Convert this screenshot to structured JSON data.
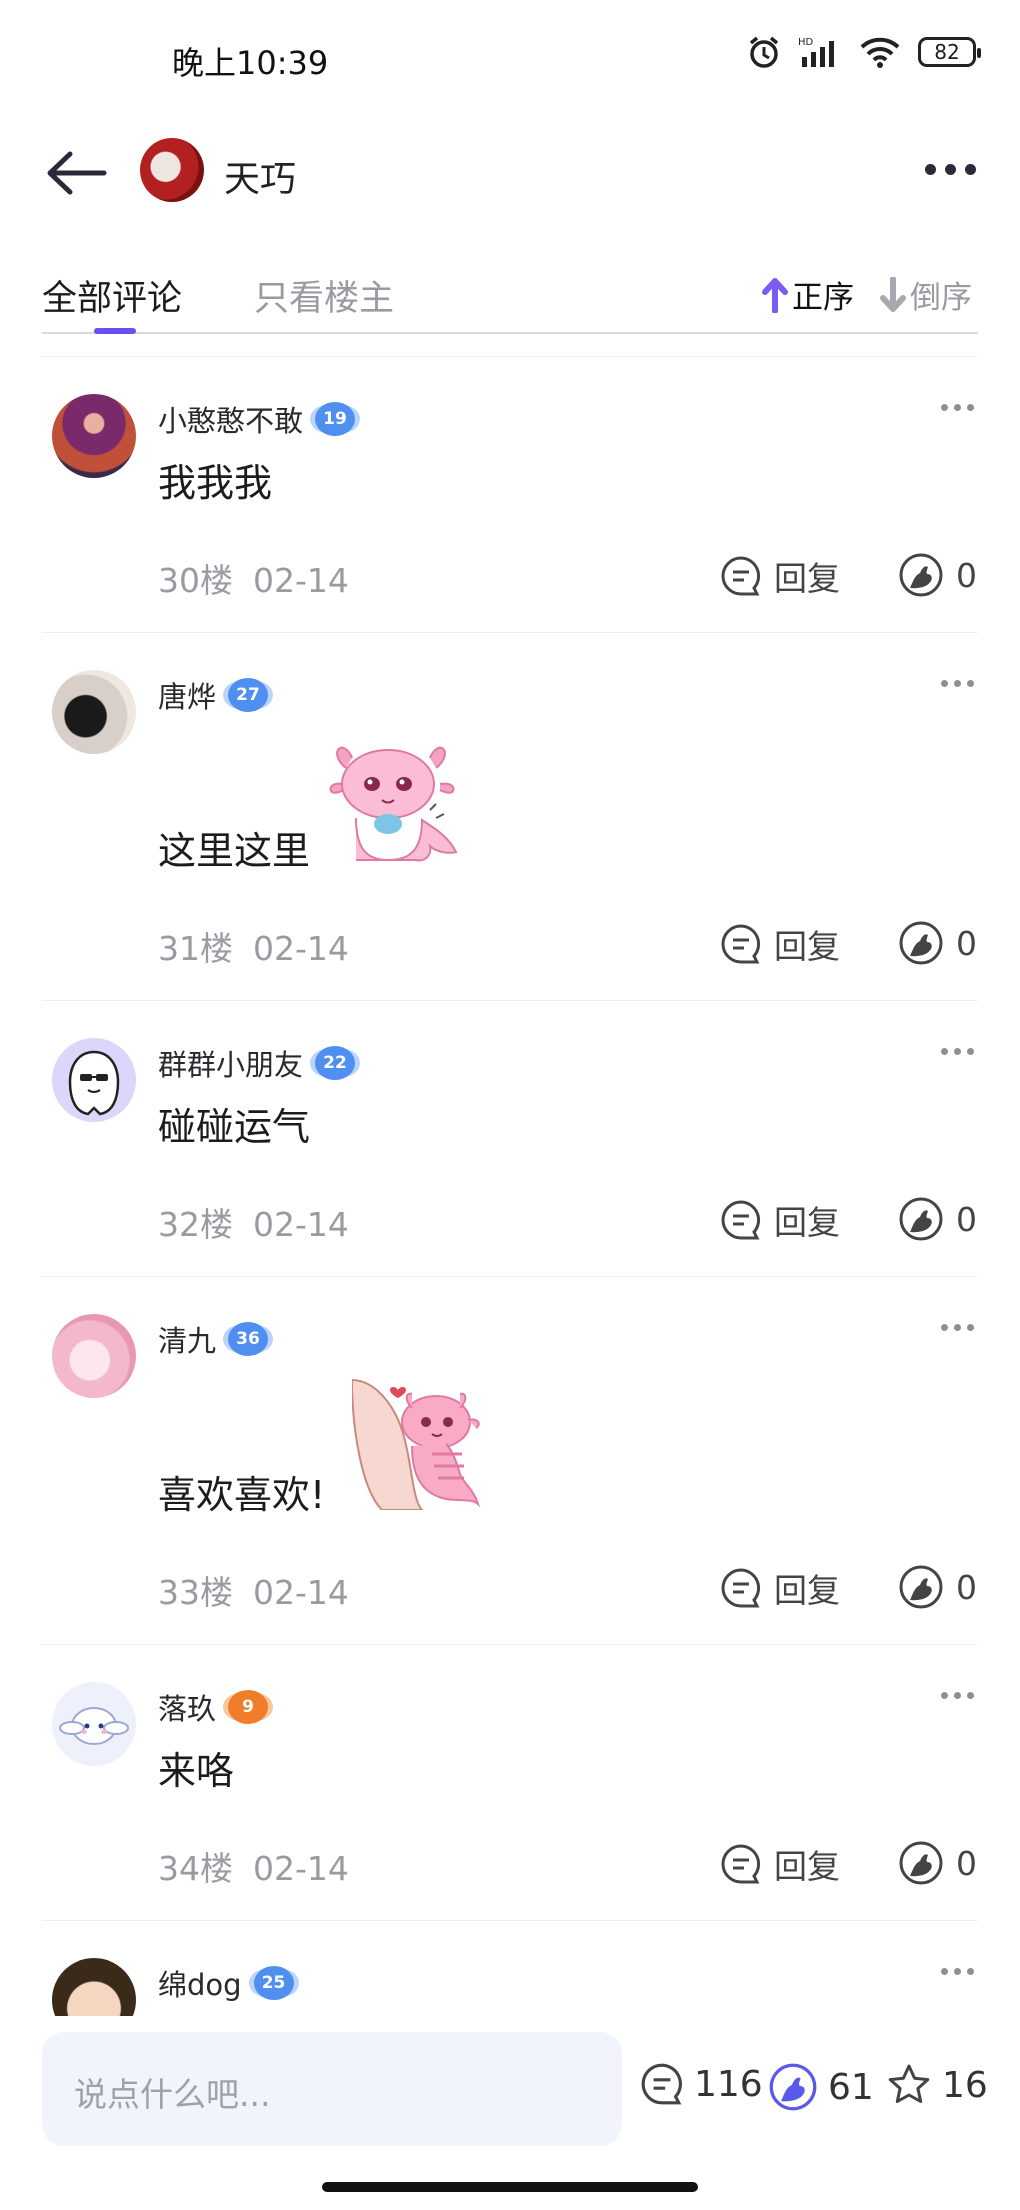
{
  "status_bar": {
    "time": "晚上10:39",
    "battery": "82",
    "network": "HD"
  },
  "header": {
    "user_name": "天巧"
  },
  "tabs": {
    "all": "全部评论",
    "owner_only": "只看楼主",
    "sort_asc": "正序",
    "sort_desc": "倒序"
  },
  "comments": [
    {
      "name": "小憨憨不敢",
      "level": "19",
      "badge_color": "#4f8ff0",
      "text": "我我我",
      "floor": "30楼",
      "date": "02-14",
      "reply_label": "回复",
      "likes": "0"
    },
    {
      "name": "唐烨",
      "level": "27",
      "badge_color": "#4f8ff0",
      "text": "这里这里",
      "floor": "31楼",
      "date": "02-14",
      "reply_label": "回复",
      "likes": "0",
      "sticker": "pink-axolotl-sticker"
    },
    {
      "name": "群群小朋友",
      "level": "22",
      "badge_color": "#4f8ff0",
      "text": "碰碰运气",
      "floor": "32楼",
      "date": "02-14",
      "reply_label": "回复",
      "likes": "0"
    },
    {
      "name": "清九",
      "level": "36",
      "badge_color": "#4f8ff0",
      "text": "喜欢喜欢!",
      "floor": "33楼",
      "date": "02-14",
      "reply_label": "回复",
      "likes": "0",
      "sticker": "pink-axolotl-hug-sticker"
    },
    {
      "name": "落玖",
      "level": "9",
      "badge_color": "#f07d2a",
      "text": "来咯",
      "floor": "34楼",
      "date": "02-14",
      "reply_label": "回复",
      "likes": "0"
    },
    {
      "name": "绵dog",
      "level": "25",
      "badge_color": "#4f8ff0"
    }
  ],
  "bottom_bar": {
    "input_placeholder": "说点什么吧...",
    "comment_count": "116",
    "like_count": "61",
    "favorite_count": "16"
  }
}
